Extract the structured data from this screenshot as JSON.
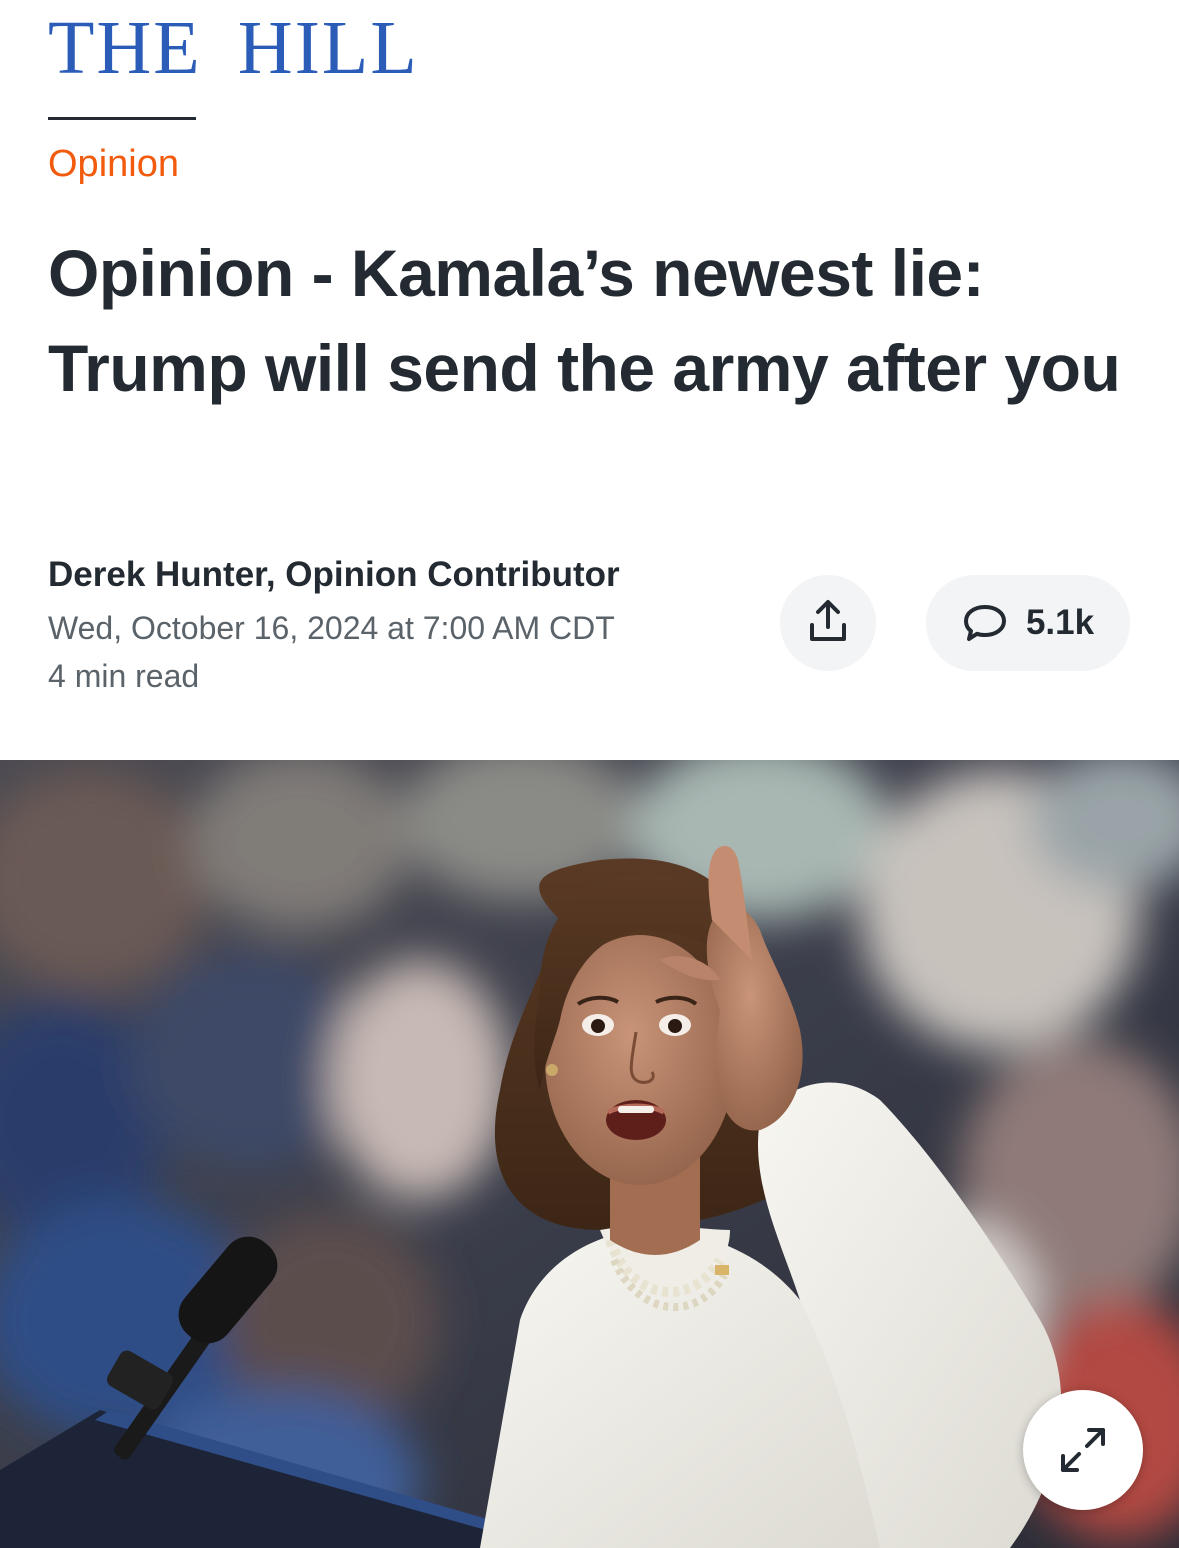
{
  "masthead": {
    "logo_word_1": "THE",
    "logo_word_2": "HILL",
    "brand_color": "#2a5cb8"
  },
  "section": {
    "label": "Opinion",
    "color": "#f25a0d"
  },
  "article": {
    "headline": "Opinion - Kamala’s newest lie: Trump will send the army after you",
    "byline": "Derek Hunter, Opinion Contributor",
    "dateline": "Wed, October 16, 2024 at 7:00 AM CDT",
    "read_time": "4 min read"
  },
  "actions": {
    "share_icon": "share-icon",
    "comment_icon": "comment-icon",
    "comments_count": "5.1k"
  },
  "hero": {
    "subject": "Photo of Kamala Harris in a white blazer raising her index finger at a podium with a microphone, blurred crowd in background",
    "expand_icon": "expand-icon"
  }
}
